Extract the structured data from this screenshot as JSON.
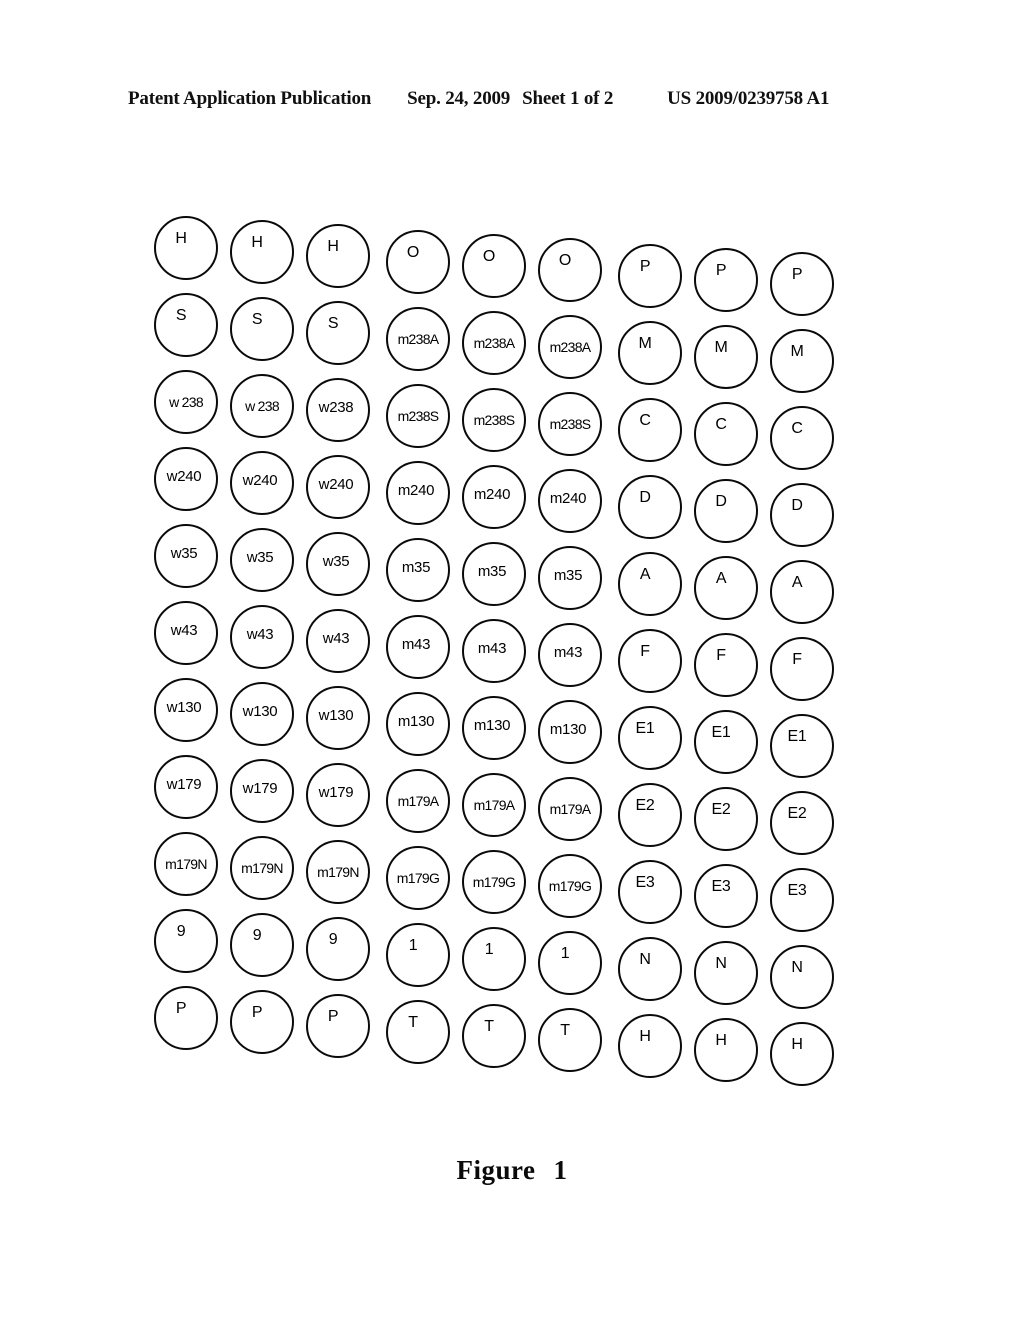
{
  "header": {
    "publication": "Patent Application Publication",
    "date": "Sep. 24, 2009",
    "sheet": "Sheet 1 of 2",
    "publication_number": "US 2009/0239758 A1"
  },
  "figure": {
    "caption_word": "Figure",
    "caption_number": "1"
  },
  "grid": {
    "rows": 11,
    "columns": 9,
    "shape": "circle",
    "stroke_color": "#0a0a0a",
    "fill_color": "#ffffff",
    "cells": [
      [
        "H",
        "H",
        "H",
        "O",
        "O",
        "O",
        "P",
        "P",
        "P"
      ],
      [
        "S",
        "S",
        "S",
        "m238A",
        "m238A",
        "m238A",
        "M",
        "M",
        "M"
      ],
      [
        "w 238",
        "w 238",
        "w238",
        "m238S",
        "m238S",
        "m238S",
        "C",
        "C",
        "C"
      ],
      [
        "w240",
        "w240",
        "w240",
        "m240",
        "m240",
        "m240",
        "D",
        "D",
        "D"
      ],
      [
        "w35",
        "w35",
        "w35",
        "m35",
        "m35",
        "m35",
        "A",
        "A",
        "A"
      ],
      [
        "w43",
        "w43",
        "w43",
        "m43",
        "m43",
        "m43",
        "F",
        "F",
        "F"
      ],
      [
        "w130",
        "w130",
        "w130",
        "m130",
        "m130",
        "m130",
        "E1",
        "E1",
        "E1"
      ],
      [
        "w179",
        "w179",
        "w179",
        "m179A",
        "m179A",
        "m179A",
        "E2",
        "E2",
        "E2"
      ],
      [
        "m179N",
        "m179N",
        "m179N",
        "m179G",
        "m179G",
        "m179G",
        "E3",
        "E3",
        "E3"
      ],
      [
        "9",
        "9",
        "9",
        "1",
        "1",
        "1",
        "N",
        "N",
        "N"
      ],
      [
        "P",
        "P",
        "P",
        "T",
        "T",
        "T",
        "H",
        "H",
        "H"
      ]
    ]
  }
}
